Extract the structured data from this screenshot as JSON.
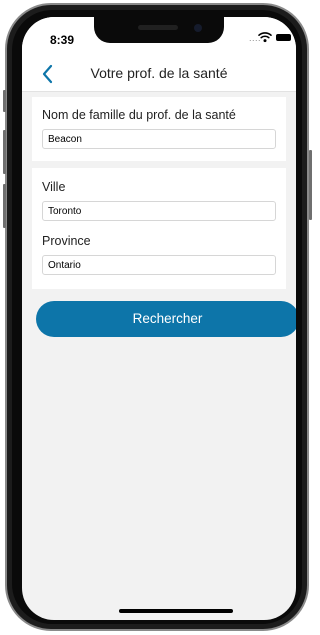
{
  "status": {
    "time": "8:39",
    "signal_dots": "...."
  },
  "nav": {
    "title": "Votre prof. de la santé"
  },
  "form": {
    "last_name": {
      "label": "Nom de famille du prof. de la santé",
      "value": "Beacon"
    },
    "city": {
      "label": "Ville",
      "value": "Toronto"
    },
    "province": {
      "label": "Province",
      "value": "Ontario"
    }
  },
  "search_button": {
    "label": "Rechercher"
  },
  "colors": {
    "accent": "#0d75a9",
    "background": "#f2f2f2",
    "card": "#ffffff"
  },
  "icons": [
    "back-chevron-icon",
    "wifi-icon",
    "battery-icon"
  ]
}
